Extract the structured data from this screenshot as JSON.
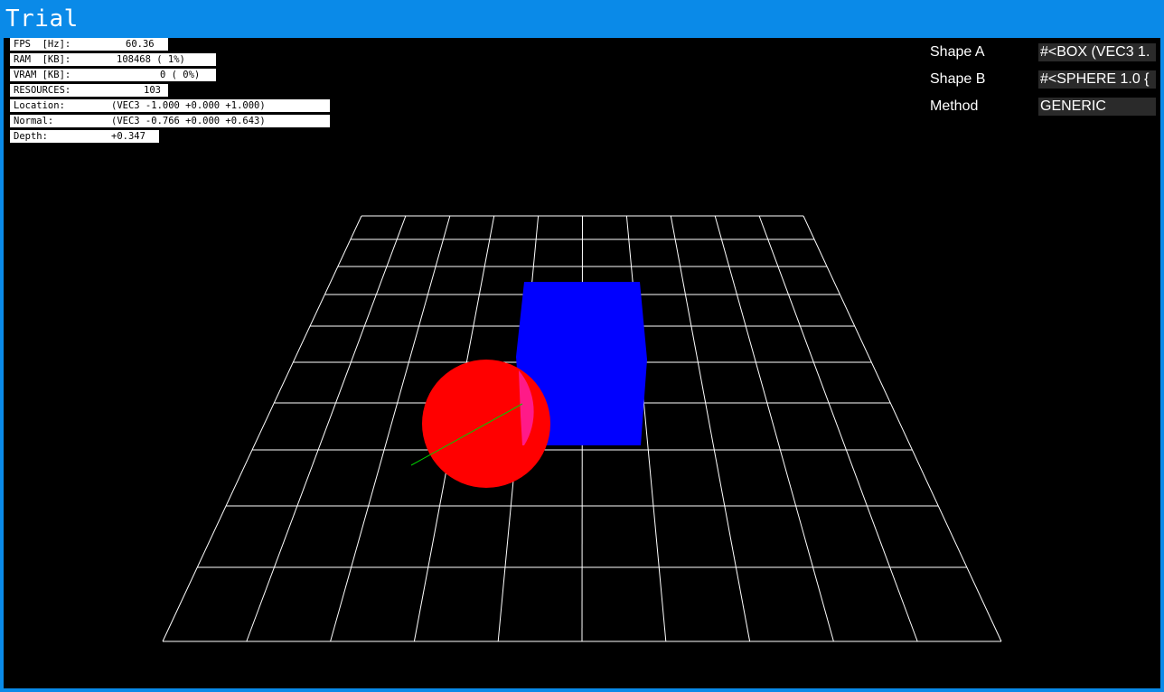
{
  "window": {
    "title": "Trial"
  },
  "stats": [
    {
      "label": "FPS  [Hz]:",
      "value": "60.36"
    },
    {
      "label": "RAM  [KB]:",
      "value": "108468 ( 1%)"
    },
    {
      "label": "VRAM [KB]:",
      "value": "0 ( 0%)"
    },
    {
      "label": "RESOURCES:",
      "value": "103"
    },
    {
      "label": "Location:",
      "value": "(VEC3 -1.000 +0.000 +1.000)"
    },
    {
      "label": "Normal:",
      "value": "(VEC3 -0.766 +0.000 +0.643)"
    },
    {
      "label": "Depth:",
      "value": "+0.347"
    }
  ],
  "panel": {
    "shape_a": {
      "label": "Shape A",
      "value": "#<BOX (VEC3 1."
    },
    "shape_b": {
      "label": "Shape B",
      "value": "#<SPHERE 1.0 {"
    },
    "method": {
      "label": "Method",
      "value": "GENERIC"
    }
  },
  "colors": {
    "titlebar": "#0a8ae8",
    "viewport": "#000000",
    "grid": "#ffffff",
    "box": "#0000ff",
    "sphere": "#ff0000",
    "overlap": "#ff2080",
    "normal_line": "#00cc00"
  }
}
